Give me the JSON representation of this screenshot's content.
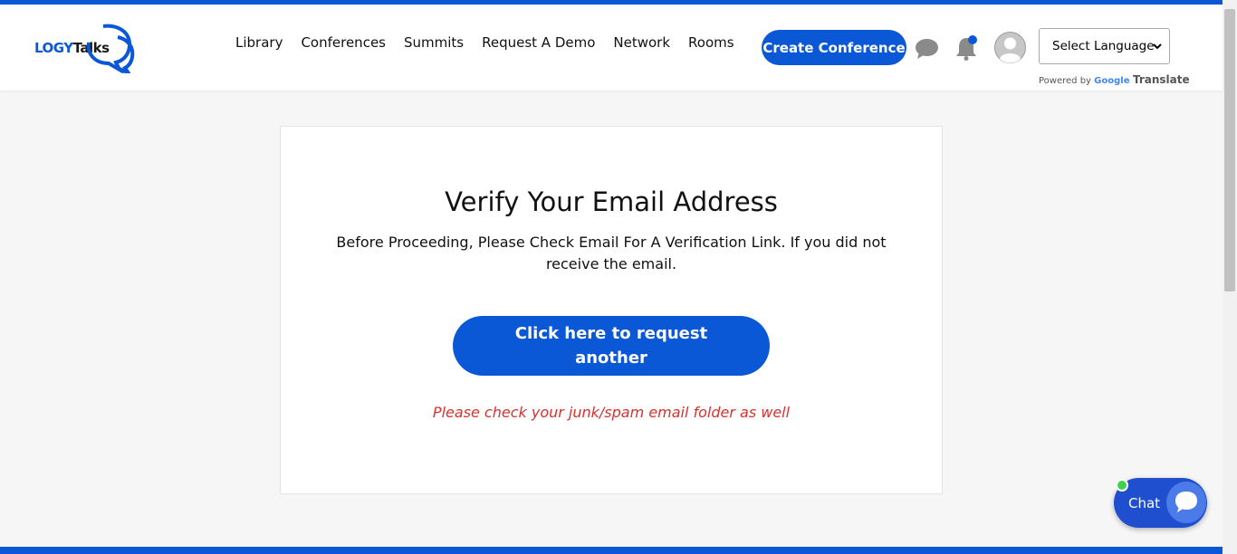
{
  "brand": {
    "logo_part1": "LOGY",
    "logo_part2": "Talks",
    "accent": "#0a58d6"
  },
  "nav": {
    "items": [
      "Library",
      "Conferences",
      "Summits",
      "Request A Demo",
      "Network",
      "Rooms"
    ],
    "create_label": "Create Conference"
  },
  "language": {
    "selected": "Select Language",
    "powered_by": "Powered by",
    "google": "Google",
    "translate": "Translate"
  },
  "verify": {
    "title": "Verify Your Email Address",
    "message": "Before Proceeding, Please Check Email For A Verification Link. If you did not receive the email.",
    "button_label": "Click here to request another",
    "note": "Please check your junk/spam email folder as well",
    "note_color": "#d9302c"
  },
  "chat_widget": {
    "label": "Chat"
  },
  "icons": [
    "chat-bubble-icon",
    "bell-icon",
    "user-avatar-icon",
    "chevron-down-icon",
    "chat-widget-icon"
  ]
}
